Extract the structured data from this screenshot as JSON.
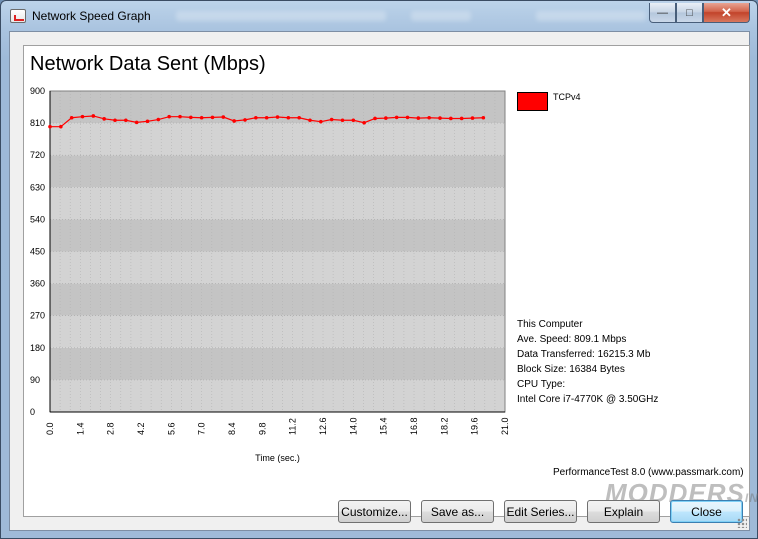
{
  "window": {
    "title": "Network Speed Graph",
    "minimize_glyph": "—",
    "maximize_glyph": "□",
    "close_glyph": "✕"
  },
  "graph": {
    "title": "Network Data Sent (Mbps)",
    "legend": [
      {
        "label": "TCPv4",
        "color": "#ff0000"
      }
    ],
    "stats": {
      "computer": "This Computer",
      "ave_speed": "Ave. Speed: 809.1 Mbps",
      "data_transferred": "Data Transferred: 16215.3 Mb",
      "block_size": "Block Size: 16384 Bytes",
      "cpu_type_label": "CPU Type:",
      "cpu_type_value": "Intel Core i7-4770K @ 3.50GHz"
    },
    "footer": "PerformanceTest 8.0 (www.passmark.com)"
  },
  "watermark": {
    "text": "MODDERS",
    "suffix": "INC"
  },
  "buttons": {
    "customize": "Customize...",
    "save_as": "Save as...",
    "edit_series": "Edit Series...",
    "explain": "Explain",
    "close": "Close"
  },
  "chart_data": {
    "type": "line",
    "title": "Network Data Sent (Mbps)",
    "xlabel": "Time (sec.)",
    "ylabel": "",
    "xlim": [
      0.0,
      21.0
    ],
    "ylim": [
      0,
      900
    ],
    "x_ticks": [
      "0.0",
      "1.4",
      "2.8",
      "4.2",
      "5.6",
      "7.0",
      "8.4",
      "9.8",
      "11.2",
      "12.6",
      "14.0",
      "15.4",
      "16.8",
      "18.2",
      "19.6",
      "21.0"
    ],
    "y_ticks": [
      "0",
      "90",
      "180",
      "270",
      "360",
      "450",
      "540",
      "630",
      "720",
      "810",
      "900"
    ],
    "grid": true,
    "legend_position": "top-right",
    "series": [
      {
        "name": "TCPv4",
        "color": "#ff0000",
        "x": [
          0.0,
          0.5,
          1.0,
          1.5,
          2.0,
          2.5,
          3.0,
          3.5,
          4.0,
          4.5,
          5.0,
          5.5,
          6.0,
          6.5,
          7.0,
          7.5,
          8.0,
          8.5,
          9.0,
          9.5,
          10.0,
          10.5,
          11.0,
          11.5,
          12.0,
          12.5,
          13.0,
          13.5,
          14.0,
          14.5,
          15.0,
          15.5,
          16.0,
          16.5,
          17.0,
          17.5,
          18.0,
          18.5,
          19.0,
          19.5,
          20.0
        ],
        "values": [
          800,
          800,
          825,
          828,
          830,
          822,
          818,
          818,
          812,
          815,
          820,
          828,
          828,
          826,
          825,
          826,
          827,
          816,
          819,
          825,
          825,
          827,
          825,
          825,
          818,
          814,
          820,
          818,
          818,
          811,
          823,
          824,
          826,
          826,
          824,
          825,
          824,
          823,
          823,
          824,
          825
        ]
      }
    ]
  }
}
